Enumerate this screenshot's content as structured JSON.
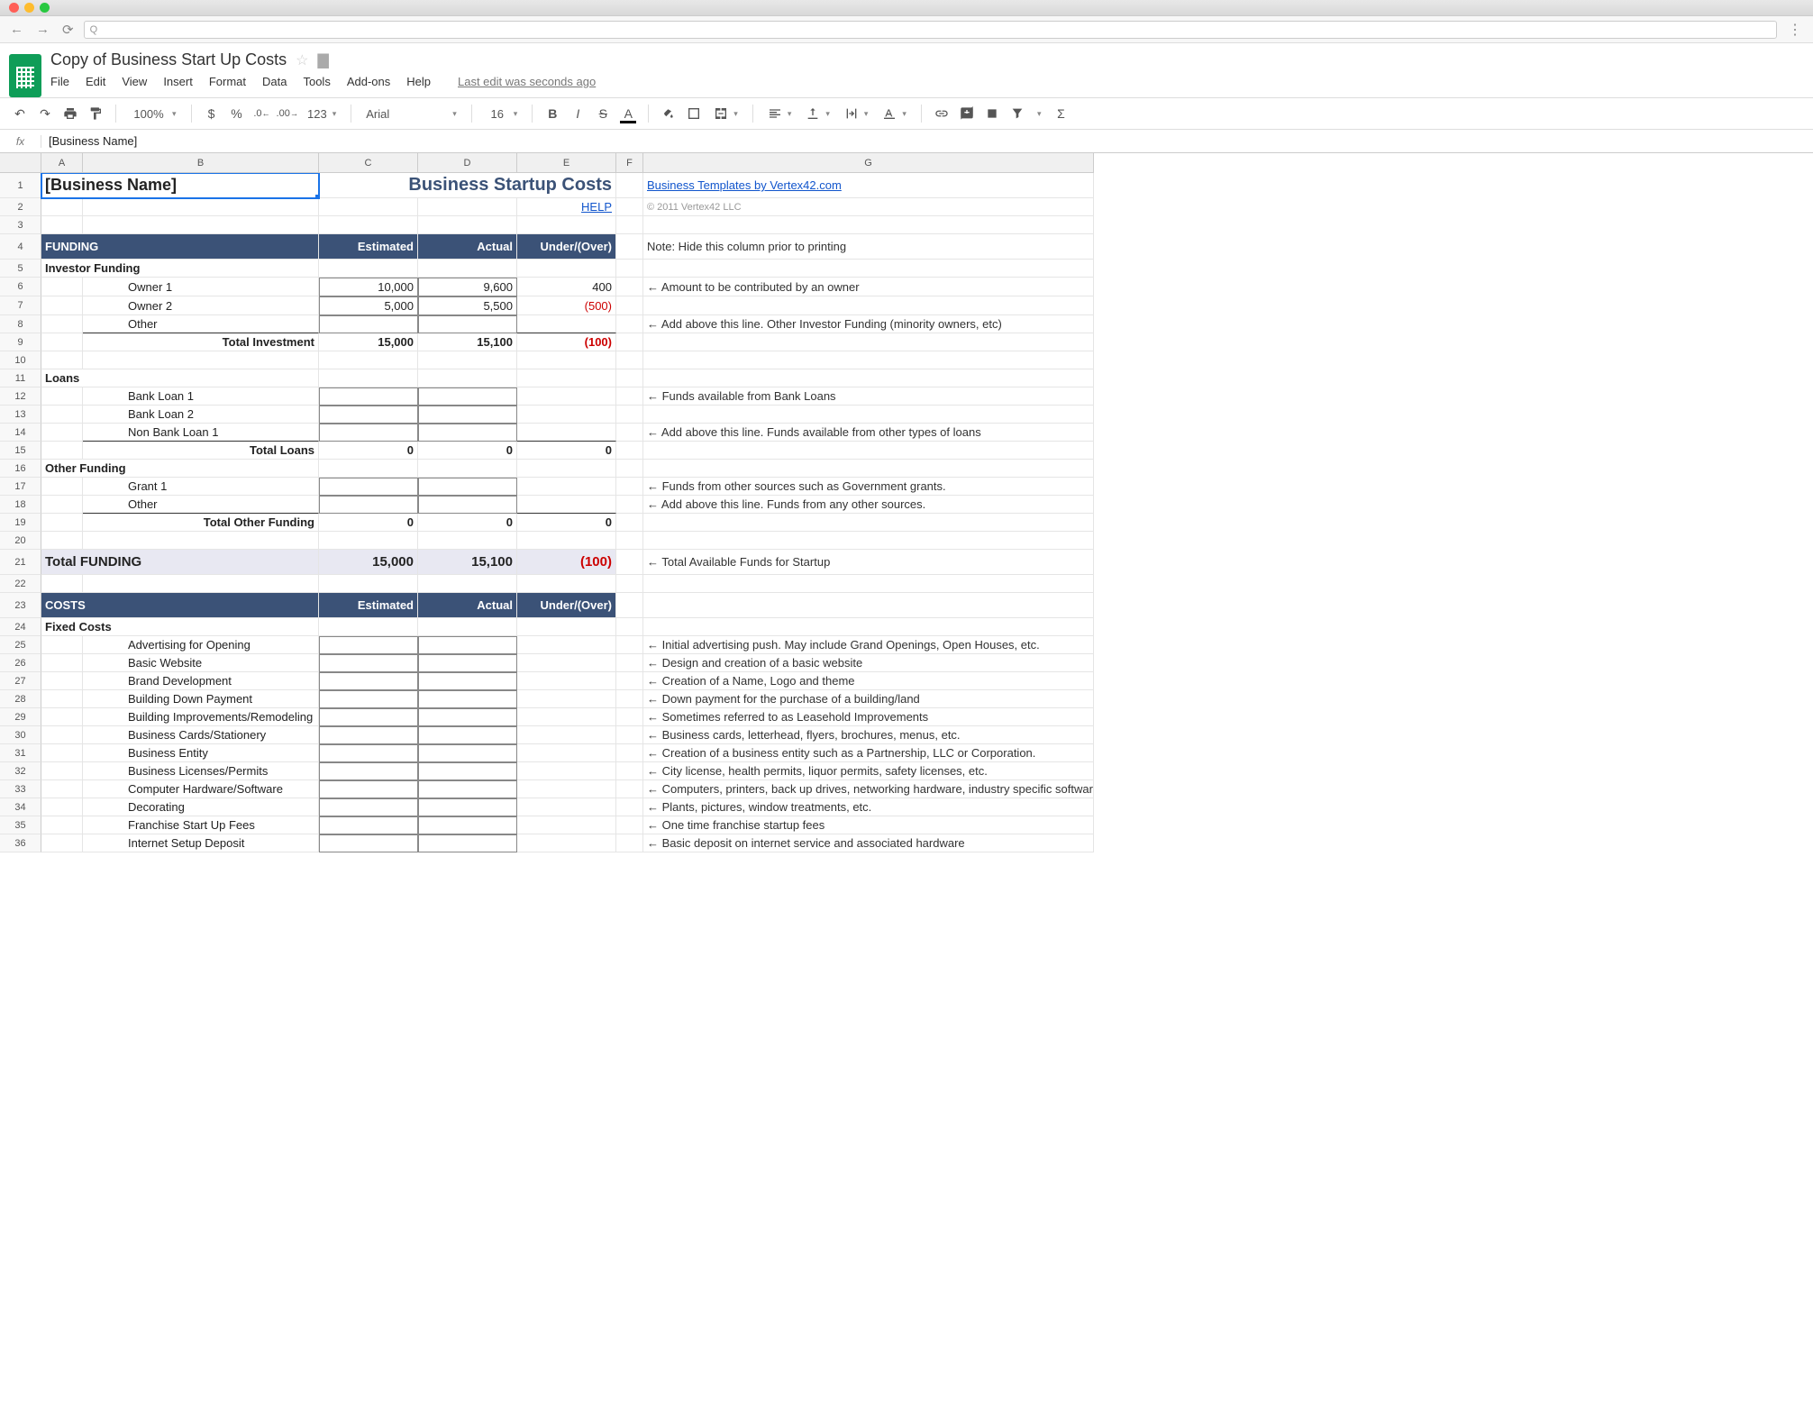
{
  "browser": {
    "url_prefix": "Q"
  },
  "doc": {
    "title": "Copy of Business Start Up Costs",
    "menus": [
      "File",
      "Edit",
      "View",
      "Insert",
      "Format",
      "Data",
      "Tools",
      "Add-ons",
      "Help"
    ],
    "last_edit": "Last edit was seconds ago"
  },
  "toolbar": {
    "zoom": "100%",
    "currency": "$",
    "percent": "%",
    "dec_dec": ".0",
    "dec_inc": ".00",
    "fmt123": "123",
    "font": "Arial",
    "font_size": "16",
    "bold": "B",
    "italic": "I",
    "strike": "S",
    "textcolor": "A"
  },
  "formula": {
    "fx": "fx",
    "value": "[Business Name]"
  },
  "columns": [
    "A",
    "B",
    "C",
    "D",
    "E",
    "F",
    "G"
  ],
  "sheet": {
    "title_main": "Business Startup Costs",
    "biz_name": "[Business Name]",
    "help": "HELP",
    "templates_link": "Business Templates by Vertex42.com",
    "copyright": "© 2011 Vertex42 LLC",
    "print_note": "Note: Hide this column prior to printing",
    "section_funding": "FUNDING",
    "section_costs": "COSTS",
    "col_est": "Estimated",
    "col_act": "Actual",
    "col_uo": "Under/(Over)",
    "investor_hdr": "Investor Funding",
    "owner1": "Owner 1",
    "owner1_est": "10,000",
    "owner1_act": "9,600",
    "owner1_uo": "400",
    "owner2": "Owner 2",
    "owner2_est": "5,000",
    "owner2_act": "5,500",
    "owner2_uo": "(500)",
    "inv_other": "Other",
    "total_investment": "Total Investment",
    "ti_est": "15,000",
    "ti_act": "15,100",
    "ti_uo": "(100)",
    "loans_hdr": "Loans",
    "bank1": "Bank Loan 1",
    "bank2": "Bank Loan 2",
    "nonbank1": "Non Bank Loan 1",
    "total_loans": "Total Loans",
    "tl_est": "0",
    "tl_act": "0",
    "tl_uo": "0",
    "other_funding_hdr": "Other Funding",
    "grant1": "Grant 1",
    "of_other": "Other",
    "total_other_funding": "Total Other Funding",
    "tof_est": "0",
    "tof_act": "0",
    "tof_uo": "0",
    "total_funding": "Total FUNDING",
    "tf_est": "15,000",
    "tf_act": "15,100",
    "tf_uo": "(100)",
    "fixed_costs_hdr": "Fixed Costs",
    "fc": [
      {
        "label": "Advertising for Opening",
        "note": "← Initial advertising push.  May include Grand Openings, Open Houses, etc."
      },
      {
        "label": "Basic Website",
        "note": "← Design and creation of a basic website"
      },
      {
        "label": "Brand Development",
        "note": "← Creation of a Name, Logo and theme"
      },
      {
        "label": "Building Down Payment",
        "note": "← Down payment for the purchase of a building/land"
      },
      {
        "label": "Building Improvements/Remodeling",
        "note": "← Sometimes referred to as Leasehold Improvements"
      },
      {
        "label": "Business Cards/Stationery",
        "note": "← Business cards, letterhead, flyers, brochures, menus, etc."
      },
      {
        "label": "Business Entity",
        "note": "← Creation of a business entity such as a Partnership, LLC or Corporation."
      },
      {
        "label": "Business Licenses/Permits",
        "note": "← City license, health permits, liquor permits, safety licenses, etc."
      },
      {
        "label": "Computer Hardware/Software",
        "note": "← Computers, printers, back up drives, networking hardware, industry specific software o"
      },
      {
        "label": "Decorating",
        "note": "← Plants, pictures, window treatments, etc."
      },
      {
        "label": "Franchise Start Up Fees",
        "note": "← One time franchise startup fees"
      },
      {
        "label": "Internet Setup Deposit",
        "note": "← Basic deposit on internet service and associated hardware"
      }
    ],
    "notes": {
      "n6": "← Amount to be contributed by an owner",
      "n8": "← Add above this line. Other Investor Funding (minority owners, etc)",
      "n12": "← Funds available from Bank Loans",
      "n14": "← Add above this line. Funds available from other types of loans",
      "n17": "← Funds from other sources such as Government grants.",
      "n18": "← Add above this line. Funds from any other sources.",
      "n21": "← Total Available Funds for Startup"
    }
  }
}
